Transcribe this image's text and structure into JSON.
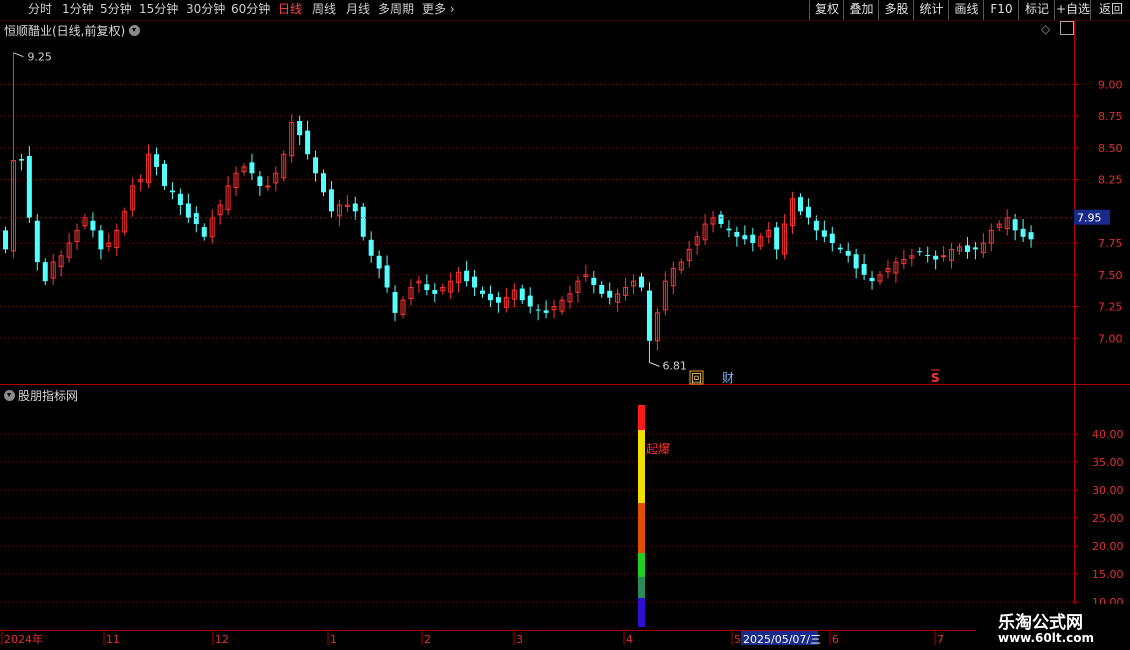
{
  "toolbar": {
    "periods": [
      "分时",
      "1分钟",
      "5分钟",
      "15分钟",
      "30分钟",
      "60分钟",
      "日线",
      "周线",
      "月线",
      "多周期",
      "更多"
    ],
    "active_period": "日线",
    "right_buttons": [
      "复权",
      "叠加",
      "多股",
      "统计",
      "画线",
      "F10",
      "标记",
      "+自选",
      "返回"
    ]
  },
  "main_panel": {
    "title": "恒顺醋业(日线,前复权)",
    "high_label": "9.25",
    "low_label": "6.81",
    "last_price": "7.95",
    "y_ticks": [
      "9.00",
      "8.75",
      "8.50",
      "8.25",
      "7.75",
      "7.50",
      "7.25",
      "7.00"
    ],
    "markers": {
      "hui": "回",
      "cai": "财",
      "s": "S"
    }
  },
  "indicator_panel": {
    "title": "股朋指标网",
    "y_ticks": [
      "40.00",
      "35.00",
      "30.00",
      "25.00",
      "20.00",
      "15.00",
      "10.00"
    ],
    "signal_label": "起爆"
  },
  "time_axis": {
    "labels": [
      "2024年",
      "11",
      "12",
      "1",
      "2",
      "3",
      "4",
      "5",
      "6",
      "7"
    ],
    "cursor_date": "2025/05/07/三"
  },
  "watermark": {
    "name": "乐淘公式网",
    "url": "www.60lt.com"
  },
  "colors": {
    "up": "#ff3333",
    "down": "#54ffff",
    "axis": "#b00000",
    "grid": "#7a0000",
    "accent": "#ff4444"
  },
  "chart_data": {
    "type": "candlestick",
    "y_range": [
      6.75,
      9.35
    ],
    "closes": [
      7.7,
      8.4,
      8.4,
      7.95,
      7.6,
      7.45,
      7.6,
      7.65,
      7.75,
      7.85,
      7.95,
      7.85,
      7.7,
      7.75,
      7.85,
      8.0,
      8.2,
      8.25,
      8.45,
      8.35,
      8.2,
      8.15,
      8.05,
      7.95,
      7.9,
      7.8,
      7.95,
      8.05,
      8.2,
      8.3,
      8.35,
      8.3,
      8.2,
      8.2,
      8.3,
      8.45,
      8.7,
      8.6,
      8.45,
      8.3,
      8.15,
      8.0,
      8.05,
      8.05,
      8.0,
      7.8,
      7.65,
      7.55,
      7.4,
      7.2,
      7.3,
      7.4,
      7.45,
      7.38,
      7.35,
      7.4,
      7.45,
      7.52,
      7.45,
      7.4,
      7.35,
      7.3,
      7.28,
      7.32,
      7.38,
      7.3,
      7.25,
      7.22,
      7.2,
      7.25,
      7.3,
      7.35,
      7.45,
      7.5,
      7.42,
      7.35,
      7.32,
      7.35,
      7.4,
      7.45,
      7.4,
      6.98,
      7.2,
      7.45,
      7.55,
      7.6,
      7.7,
      7.8,
      7.9,
      7.95,
      7.9,
      7.85,
      7.8,
      7.78,
      7.75,
      7.8,
      7.85,
      7.7,
      7.9,
      8.1,
      8.0,
      7.95,
      7.85,
      7.8,
      7.75,
      7.7,
      7.65,
      7.55,
      7.5,
      7.45,
      7.5,
      7.55,
      7.6,
      7.62,
      7.65,
      7.68,
      7.65,
      7.62,
      7.65,
      7.7,
      7.72,
      7.68,
      7.7,
      7.75,
      7.85,
      7.9,
      7.95,
      7.85,
      7.8,
      7.78
    ]
  }
}
